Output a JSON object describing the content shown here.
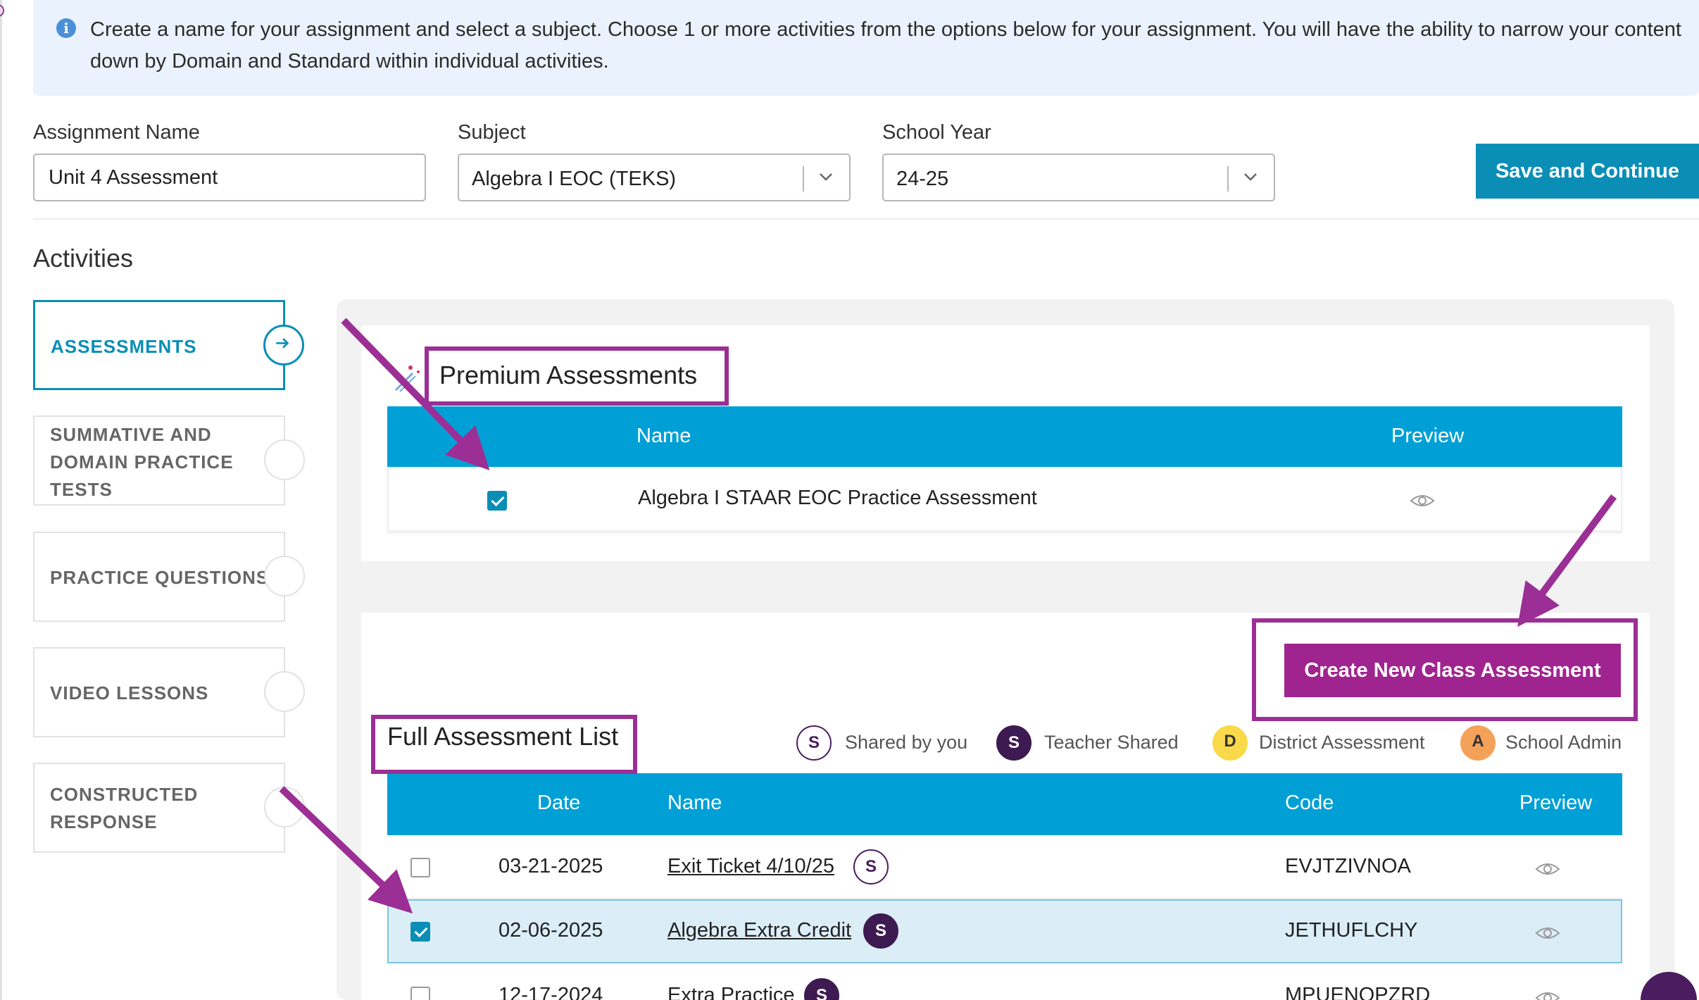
{
  "info_banner": {
    "text": "Create a name for your assignment and select a subject. Choose 1 or more activities from the options below for your assignment. You will have the ability to narrow your content down by Domain and Standard within individual activities."
  },
  "form": {
    "assignment_name": {
      "label": "Assignment Name",
      "value": "Unit 4 Assessment"
    },
    "subject": {
      "label": "Subject",
      "value": "Algebra I EOC (TEKS)"
    },
    "school_year": {
      "label": "School Year",
      "value": "24-25"
    },
    "save_label": "Save and Continue"
  },
  "activities": {
    "heading": "Activities",
    "items": [
      {
        "label": "ASSESSMENTS",
        "active": true
      },
      {
        "label": "SUMMATIVE AND DOMAIN PRACTICE TESTS",
        "active": false
      },
      {
        "label": "PRACTICE QUESTIONS",
        "active": false
      },
      {
        "label": "VIDEO LESSONS",
        "active": false
      },
      {
        "label": "CONSTRUCTED RESPONSE",
        "active": false
      }
    ]
  },
  "premium": {
    "title": "Premium Assessments",
    "columns": {
      "name": "Name",
      "preview": "Preview"
    },
    "rows": [
      {
        "checked": true,
        "name": "Algebra I STAAR EOC Practice Assessment"
      }
    ]
  },
  "full_list": {
    "create_label": "Create New Class Assessment",
    "title": "Full Assessment List",
    "legend": [
      {
        "letter": "S",
        "label": "Shared by you",
        "style": "outline"
      },
      {
        "letter": "S",
        "label": "Teacher Shared",
        "style": "solid"
      },
      {
        "letter": "D",
        "label": "District Assessment",
        "style": "yellow"
      },
      {
        "letter": "A",
        "label": "School Admin",
        "style": "orange"
      }
    ],
    "columns": {
      "date": "Date",
      "name": "Name",
      "code": "Code",
      "preview": "Preview"
    },
    "rows": [
      {
        "checked": false,
        "date": "03-21-2025",
        "name": "Exit Ticket 4/10/25",
        "badge": "S",
        "badge_style": "outline",
        "code": "EVJTZIVNOA"
      },
      {
        "checked": true,
        "date": "02-06-2025",
        "name": "Algebra Extra Credit",
        "badge": "S",
        "badge_style": "solid",
        "code": "JETHUFLCHY"
      },
      {
        "checked": false,
        "date": "12-17-2024",
        "name": "Extra Practice",
        "badge": "S",
        "badge_style": "solid",
        "code": "MPUENOPZRD"
      }
    ]
  },
  "colors": {
    "accent": "#0a8eb6",
    "table_header": "#00a0d6",
    "annotation": "#9b2f95",
    "create_button": "#a0248f",
    "badge_dark": "#3e1a52",
    "badge_yellow": "#f9d94a",
    "badge_orange": "#f4a25a"
  }
}
